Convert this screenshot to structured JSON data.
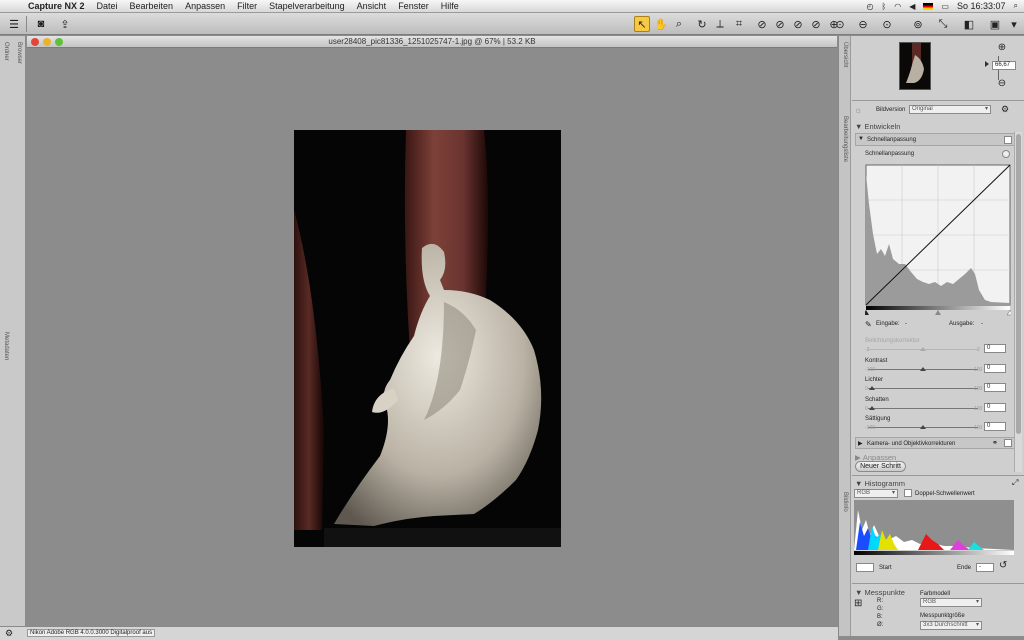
{
  "menubar": {
    "app": "Capture NX 2",
    "items": [
      "Datei",
      "Bearbeiten",
      "Anpassen",
      "Filter",
      "Stapelverarbeitung",
      "Ansicht",
      "Fenster",
      "Hilfe"
    ],
    "clock": "So 16:33:07"
  },
  "document": {
    "title": "user28408_pic81336_1251025747-1.jpg @ 67% | 53.2 KB"
  },
  "left_tabs": {
    "ordner": "Ordner",
    "browser": "Browser",
    "metadaten": "Metadaten"
  },
  "right_tabs": {
    "uebersicht": "Übersicht",
    "bearbeitungsliste": "Bearbeitungsliste",
    "bildinfo": "Bildinfo"
  },
  "overview": {
    "zoom": "66,67"
  },
  "edit_list": {
    "version_label": "Bildversion",
    "version_value": "Original",
    "develop": "Entwickeln",
    "quick_fix": "Schnellanpassung",
    "quick_fix_sub": "Schnellanpassung",
    "input_label": "Eingabe:",
    "input_value": "-",
    "output_label": "Ausgabe:",
    "output_value": "-",
    "sliders": [
      {
        "label": "Belichtungskorrektur",
        "min": "-2",
        "max": "2",
        "value": "0",
        "dim": true
      },
      {
        "label": "Kontrast",
        "min": "-100",
        "max": "100",
        "value": "0",
        "dim": false
      },
      {
        "label": "Lichter",
        "min": "0",
        "max": "100",
        "value": "0",
        "dim": false
      },
      {
        "label": "Schatten",
        "min": "0",
        "max": "100",
        "value": "0",
        "dim": false
      },
      {
        "label": "Sättigung",
        "min": "-100",
        "max": "100",
        "value": "0",
        "dim": false
      }
    ],
    "camera": "Kamera- und Objektivkorrekturen",
    "adjust": "Anpassen",
    "new_step": "Neuer Schritt"
  },
  "histogram": {
    "title": "Histogramm",
    "channel": "RGB",
    "double_threshold": "Doppel-Schwellenwert",
    "start_label": "Start",
    "end_label": "Ende",
    "end_value": "-"
  },
  "measure": {
    "title": "Messpunkte",
    "r": "R:",
    "g": "G:",
    "b": "B:",
    "o": "Ø:",
    "color_model_label": "Farbmodell",
    "color_model": "RGB",
    "size_label": "Messpunktgröße",
    "size": "3x3 Durchschnitt"
  },
  "status": {
    "text": "Nikon Adobe RGB 4.0.0.3000 Digitalproof aus"
  }
}
